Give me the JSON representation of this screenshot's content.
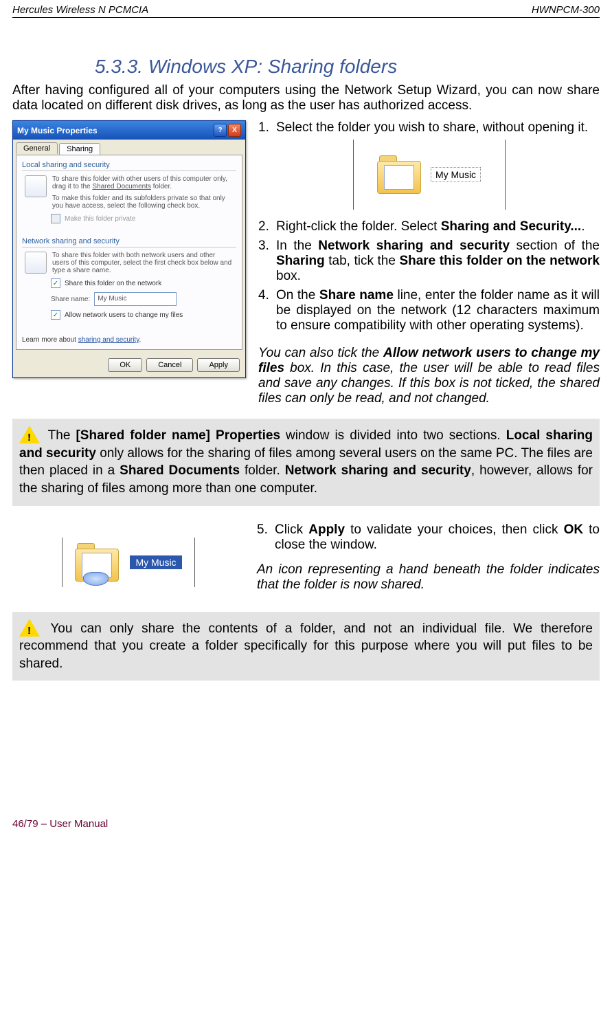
{
  "header": {
    "left": "Hercules Wireless N PCMCIA",
    "right": "HWNPCM-300"
  },
  "section": {
    "title": "5.3.3. Windows XP: Sharing folders"
  },
  "intro": "After having configured all of your computers using the Network Setup Wizard, you can now share data located on different disk drives, as long as the user has authorized access.",
  "dialog": {
    "title": "My Music Properties",
    "help_btn": "?",
    "close_btn": "X",
    "tabs": {
      "general": "General",
      "sharing": "Sharing"
    },
    "group1": {
      "label": "Local sharing and security",
      "text1": "To share this folder with other users of this computer only, drag it to the ",
      "sd_link": "Shared Documents",
      "text1_tail": " folder.",
      "text2": "To make this folder and its subfolders private so that only you have access, select the following check box.",
      "chk_private": "Make this folder private"
    },
    "group2": {
      "label": "Network sharing and security",
      "text": "To share this folder with both network users and other users of this computer, select the first check box below and type a share name.",
      "chk_share": "Share this folder on the network",
      "share_name_label": "Share name:",
      "share_name_value": "My Music",
      "chk_allow": "Allow network users to change my files"
    },
    "learn_prefix": "Learn more about ",
    "learn_link": "sharing and security",
    "buttons": {
      "ok": "OK",
      "cancel": "Cancel",
      "apply": "Apply"
    }
  },
  "folder_label": "My Music",
  "steps": {
    "s1": {
      "num": "1.",
      "text": "Select the folder you wish to share, without opening it."
    },
    "s2": {
      "num": "2.",
      "text_a": "Right-click the folder.  Select ",
      "b": "Sharing and Security...",
      "tail": "."
    },
    "s3": {
      "num": "3.",
      "text_a": "In the ",
      "b1": "Network sharing and security",
      "mid1": " section of the ",
      "b2": "Sharing",
      "mid2": " tab, tick the ",
      "b3": "Share this folder on the network",
      "tail": " box."
    },
    "s4": {
      "num": "4.",
      "text_a": "On the ",
      "b": "Share name",
      "tail": " line, enter the folder name as it will be displayed on the network (12 characters maximum to ensure compatibility with other operating systems)."
    },
    "italic": {
      "a": "You can also tick the ",
      "b": "Allow network users to change my files",
      "c": " box.  In this case, the user will be able to read files and save any changes.  If this box is not ticked, the shared files can only be read, and not changed."
    },
    "s5": {
      "num": "5.",
      "text_a": "Click ",
      "b1": "Apply",
      "mid": " to validate your choices, then click ",
      "b2": "OK",
      "tail": " to close the window."
    },
    "shared_note": "An icon representing a hand beneath the folder indicates that the folder is now shared."
  },
  "note1": {
    "a": " The ",
    "b1": "[Shared folder name] Properties",
    "mid1": " window is divided into two sections.  ",
    "b2": "Local sharing and security",
    "mid2": " only allows for the sharing of files among several users on the same PC.  The files are then placed in a ",
    "b3": "Shared Documents",
    "mid3": " folder.  ",
    "b4": "Network sharing and security",
    "tail": ", however, allows for the sharing of files among more than one computer."
  },
  "note2": " You can only share the contents of a folder, and not an individual file.  We therefore recommend that you create a folder specifically for this purpose where you will put files to be shared.",
  "footer": "46/79 – User Manual"
}
